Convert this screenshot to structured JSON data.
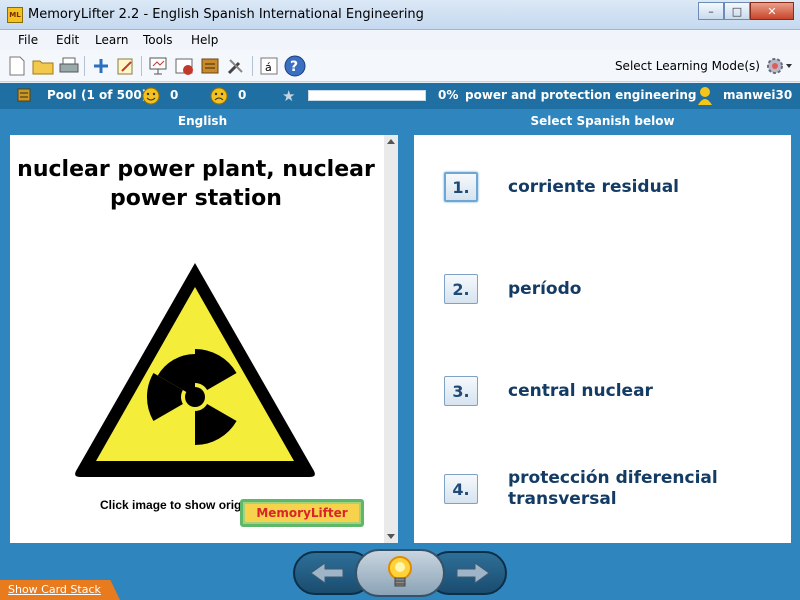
{
  "window": {
    "title": "MemoryLifter 2.2 - English Spanish International Engineering",
    "app_icon": "ML"
  },
  "menu": [
    "File",
    "Edit",
    "Learn",
    "Tools",
    "Help"
  ],
  "toolbar": {
    "learning_mode_label": "Select Learning Mode(s)"
  },
  "status": {
    "pool_label": "Pool",
    "pool_count": "(1 of 500)",
    "correct_count": "0",
    "wrong_count": "0",
    "progress_percent": 0,
    "progress_label": "0%",
    "chapter": "power and protection engineering",
    "user": "manwei30"
  },
  "question_panel": {
    "header": "English",
    "question": "nuclear power plant, nuclear power station",
    "image_hint": "Click image to show original size.",
    "logo_text": "MemoryLifter"
  },
  "answer_panel": {
    "header": "Select Spanish below",
    "answers": [
      {
        "number": "1.",
        "text": "corriente residual"
      },
      {
        "number": "2.",
        "text": "período"
      },
      {
        "number": "3.",
        "text": "central nuclear"
      },
      {
        "number": "4.",
        "text": "protección diferencial transversal"
      }
    ]
  },
  "footer": {
    "show_card_stack": "Show Card Stack"
  },
  "colors": {
    "accent": "#2f85bd",
    "status_bar": "#1f6fa2",
    "answer_text": "#133b63"
  }
}
